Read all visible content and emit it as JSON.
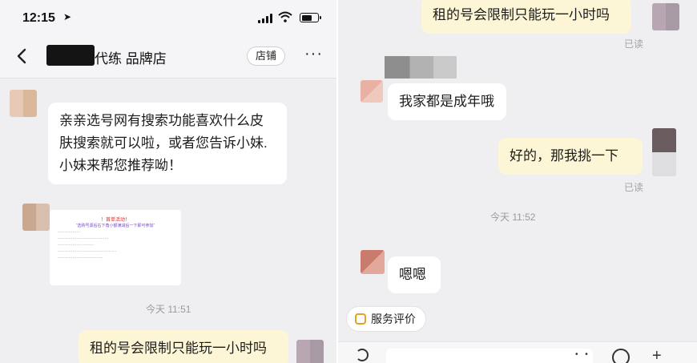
{
  "status_bar": {
    "time": "12:15",
    "location_glyph": "➤"
  },
  "nav": {
    "shop_name": "代练 品牌店",
    "shop_button": "店铺",
    "more": "···",
    "back_glyph": "‹"
  },
  "left_chat": {
    "seller_message_1": "亲亲选号网有搜索功能喜欢什么皮肤搜索就可以啦，或者您告诉小妹.小妹来帮您推荐呦！",
    "promo": {
      "title": "！首单活动！",
      "lines": [
        "“选购号源后右下角小额满减后一下即可参加”",
        "·················",
        "······································",
        "···························",
        "············································",
        "··································"
      ]
    },
    "timestamp": "今天 11:51",
    "buyer_message": "租的号会限制只能玩一小时吗"
  },
  "right_chat": {
    "buyer_message_1": "租的号会限制只能玩一小时吗",
    "read_1": "已读",
    "seller_message_1": "我家都是成年哦",
    "buyer_message_2": "好的，那我挑一下",
    "read_2": "已读",
    "timestamp": "今天 11:52",
    "seller_message_2": "嗯嗯",
    "service_review": "服务评价",
    "emoji_glyph": "• •"
  },
  "colors": {
    "chat_background": "#efeff1",
    "buyer_bubble": "#fdf6d6",
    "seller_bubble": "#ffffff",
    "service_icon": "#e8a024",
    "promo_title": "#e02a2a"
  }
}
